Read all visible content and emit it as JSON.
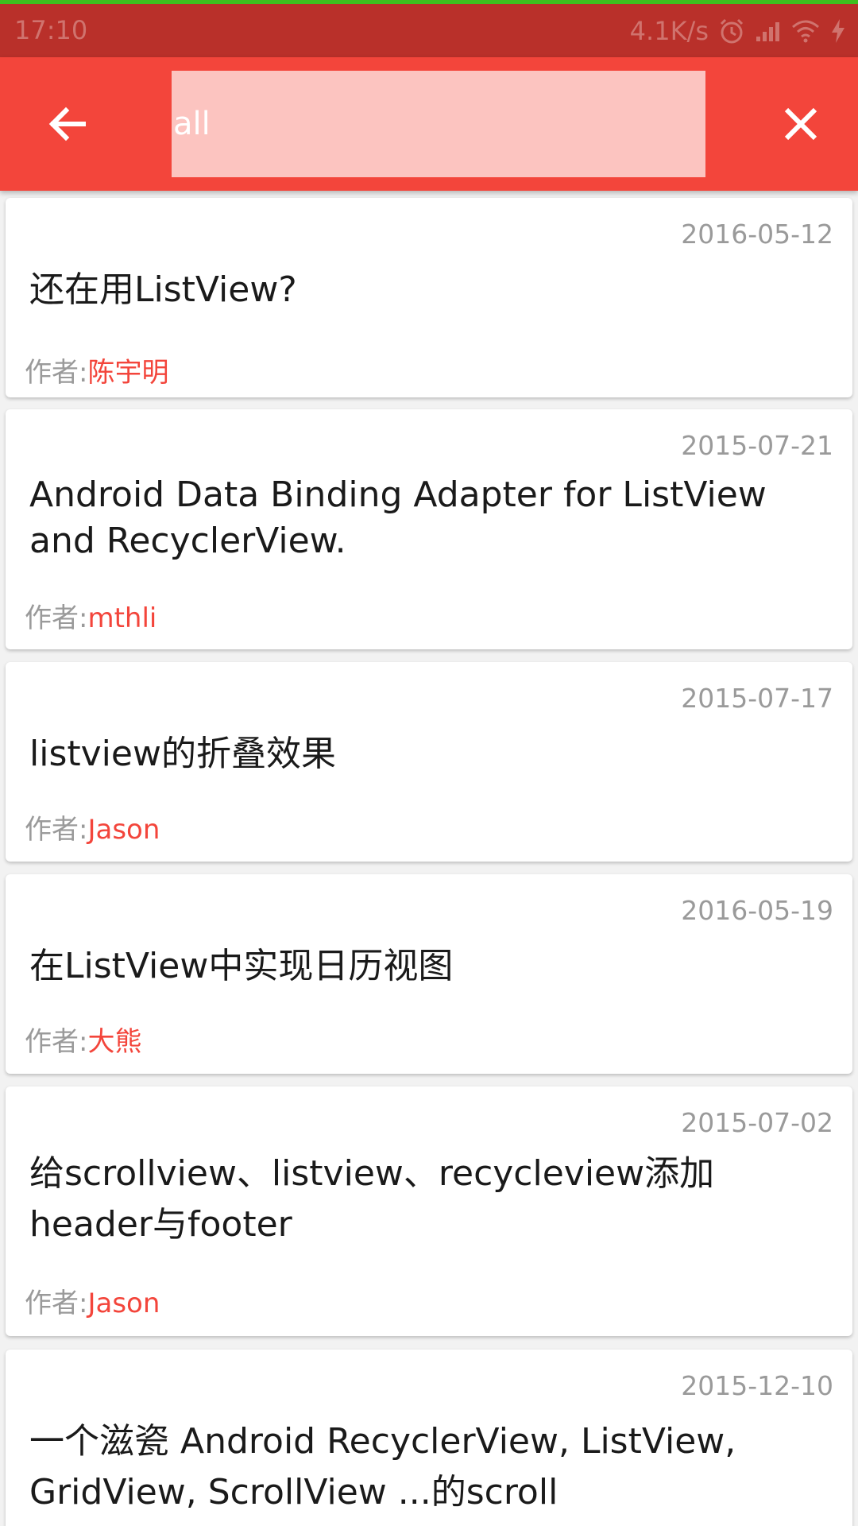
{
  "status_bar": {
    "time": "17:10",
    "speed": "4.1K/s"
  },
  "toolbar": {
    "search_value": "all",
    "back_icon": "arrow-left-icon",
    "close_icon": "close-icon"
  },
  "colors": {
    "accent": "#f3453b",
    "status_bar": "#b9302a",
    "search_bg": "#fcc4c0"
  },
  "results": [
    {
      "date": "2016-05-12",
      "title": "还在用ListView?",
      "author_label": "作者:",
      "author": "陈宇明"
    },
    {
      "date": "2015-07-21",
      "title": "Android Data Binding Adapter for ListView and RecyclerView.",
      "author_label": "作者:",
      "author": "mthli"
    },
    {
      "date": "2015-07-17",
      "title": "listview的折叠效果",
      "author_label": "作者:",
      "author": "Jason"
    },
    {
      "date": "2016-05-19",
      "title": "在ListView中实现日历视图",
      "author_label": "作者:",
      "author": "大熊"
    },
    {
      "date": "2015-07-02",
      "title": "给scrollview、listview、recycleview添加header与footer",
      "author_label": "作者:",
      "author": "Jason"
    },
    {
      "date": "2015-12-10",
      "title": "一个滋瓷 Android RecyclerView, ListView, GridView, ScrollView ...的scroll",
      "author_label": "",
      "author": ""
    }
  ]
}
